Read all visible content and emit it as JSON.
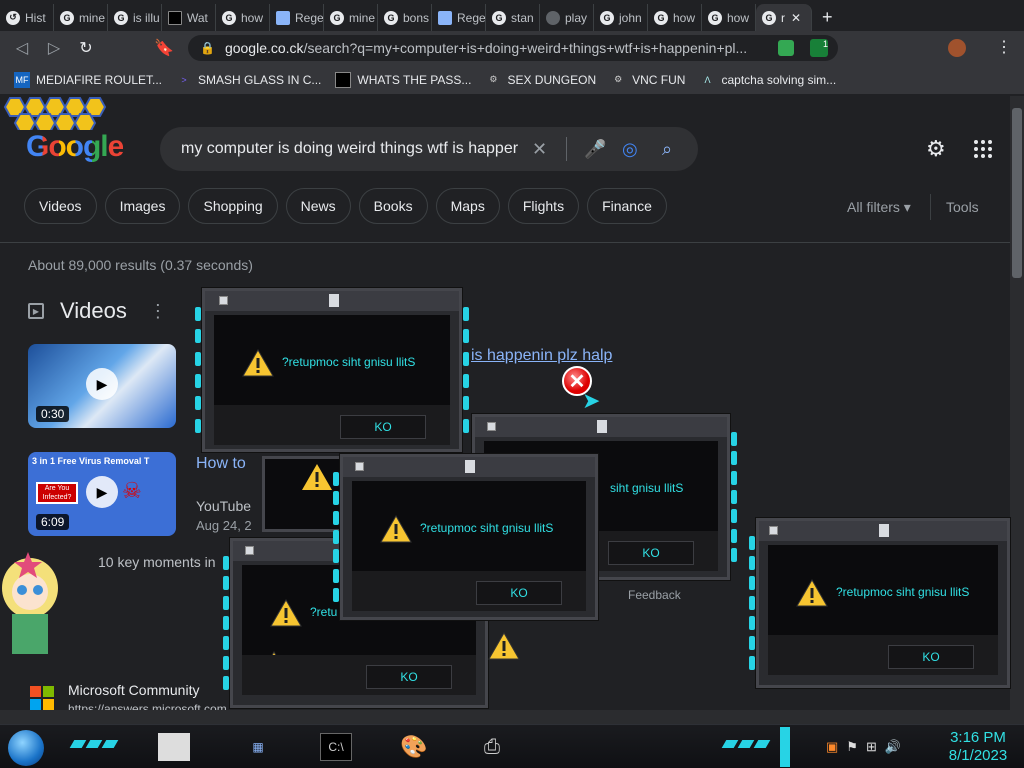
{
  "browser": {
    "tabs": [
      {
        "label": "Hist",
        "icon": "history-icon"
      },
      {
        "label": "mine",
        "icon": "google-icon"
      },
      {
        "label": "is illu",
        "icon": "google-icon"
      },
      {
        "label": "Wat",
        "icon": "site-icon"
      },
      {
        "label": "how",
        "icon": "google-icon"
      },
      {
        "label": "Rege",
        "icon": "page-icon"
      },
      {
        "label": "mine",
        "icon": "google-icon"
      },
      {
        "label": "bons",
        "icon": "google-icon"
      },
      {
        "label": "Rege",
        "icon": "page-icon"
      },
      {
        "label": "stan",
        "icon": "google-icon"
      },
      {
        "label": "play",
        "icon": "globe-icon"
      },
      {
        "label": "john",
        "icon": "google-icon"
      },
      {
        "label": "how",
        "icon": "google-icon"
      },
      {
        "label": "how",
        "icon": "google-icon"
      },
      {
        "label": "r",
        "icon": "google-icon",
        "active": true
      }
    ],
    "url_host": "google.co.ck",
    "url_path": "/search?q=my+computer+is+doing+weird+things+wtf+is+happenin+pl...",
    "extension_badge": "1",
    "bookmarks": [
      "MEDIAFIRE ROULET...",
      "SMASH GLASS IN C...",
      "WHATS THE PASS...",
      "SEX DUNGEON",
      "VNC FUN",
      "captcha solving sim..."
    ]
  },
  "search": {
    "logo": "Google",
    "query": "my computer is doing weird things wtf is happer",
    "chips": [
      "Videos",
      "Images",
      "Shopping",
      "News",
      "Books",
      "Maps",
      "Flights",
      "Finance"
    ],
    "all_filters": "All filters",
    "tools": "Tools",
    "stats": "About 89,000 results (0.37 seconds)",
    "videos_heading": "Videos",
    "video1": {
      "duration": "0:30",
      "title_fragment": "is happenin plz halp"
    },
    "video2": {
      "duration": "6:09",
      "banner": "3 in 1 Free Virus Removal T",
      "infected": "Are You Infected?",
      "title_fragment": "How to",
      "source": "YouTube",
      "date": "Aug 24, 2"
    },
    "key_moments": "10 key moments in",
    "feedback": "Feedback",
    "ms_title": "Microsoft Community",
    "ms_url": "https://answers.microsoft.com"
  },
  "dialogs": {
    "message": "?retupmoc siht gnisu llitS",
    "message_partial_a": "siht gnisu llitS",
    "message_partial_b": "?retu",
    "ok_label": "KO"
  },
  "taskbar": {
    "time": "3:16 PM",
    "date": "8/1/2023"
  },
  "colors": {
    "dialog_text": "#31e0e4",
    "link": "#8ab4f8",
    "accent_lights": "#27d3e5"
  }
}
